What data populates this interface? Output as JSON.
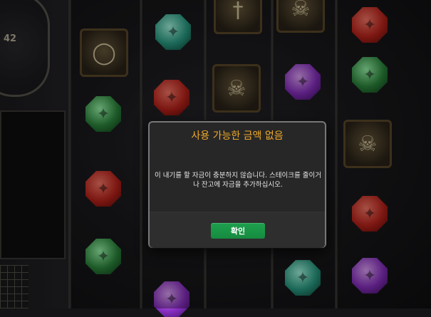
{
  "dialog": {
    "title": "사용 가능한 금액 없음",
    "message": "이 내기를 할 자금이 충분하지 않습니다. 스테이크를 줄이거나 잔고에 자금을 추가하십시오.",
    "ok_label": "확인"
  },
  "side_panel": {
    "counter": "42"
  },
  "colors": {
    "title": "#f0a92a",
    "ok_button": "#1ea14e",
    "dialog_bg": "#272727"
  },
  "symbols": [
    {
      "name": "ring-tile",
      "type": "tile",
      "icon": "ring-icon"
    },
    {
      "name": "sword-tile",
      "type": "tile",
      "icon": "sword-icon"
    },
    {
      "name": "mask-tile",
      "type": "tile",
      "icon": "mask-icon"
    },
    {
      "name": "teal-gem",
      "type": "gem",
      "color": "teal"
    },
    {
      "name": "red-gem",
      "type": "gem",
      "color": "red"
    },
    {
      "name": "green-gem",
      "type": "gem",
      "color": "green"
    },
    {
      "name": "purple-gem",
      "type": "gem",
      "color": "purple"
    }
  ]
}
